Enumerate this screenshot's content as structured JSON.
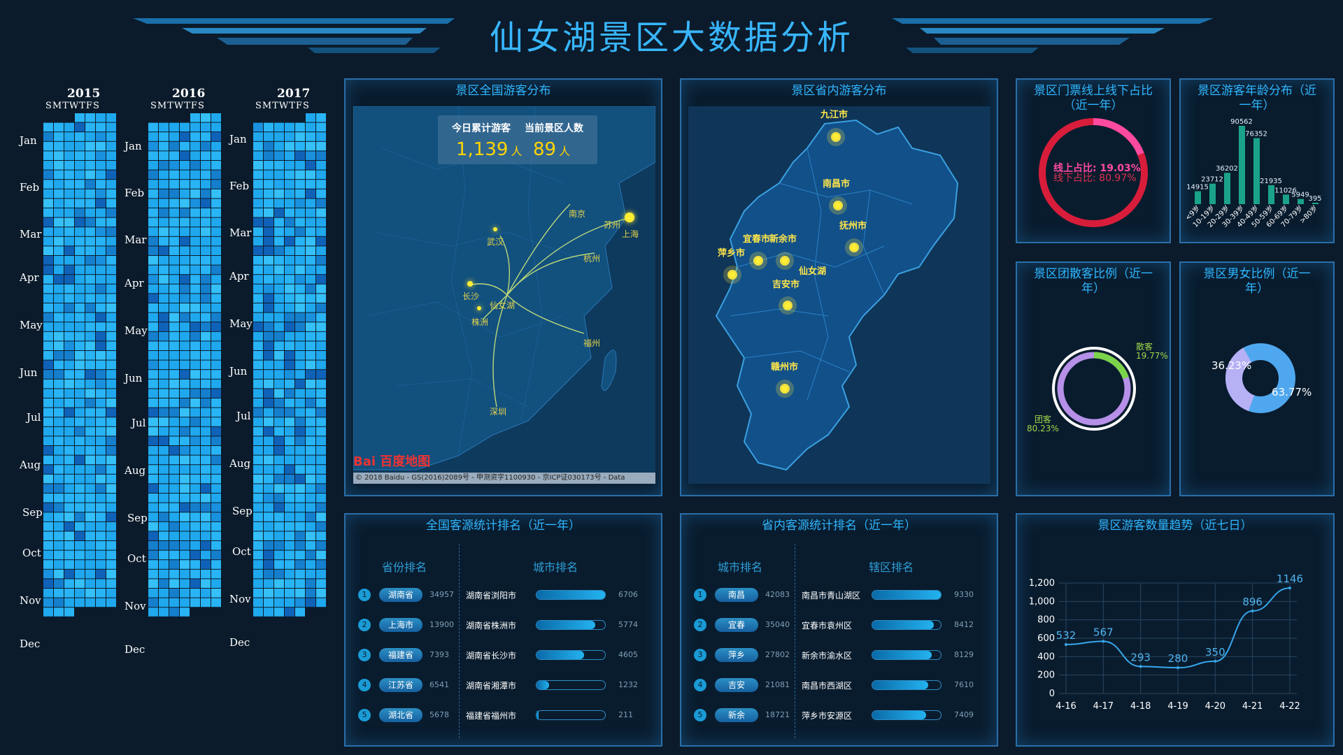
{
  "header": {
    "title": "仙女湖景区大数据分析"
  },
  "calendar": {
    "years": [
      "2015",
      "2016",
      "2017"
    ],
    "weekday_header": "SMTWTFS",
    "months": [
      "Jan",
      "Feb",
      "Mar",
      "Apr",
      "May",
      "Jun",
      "Jul",
      "Aug",
      "Sep",
      "Oct",
      "Nov",
      "Dec"
    ]
  },
  "national_map": {
    "title": "景区全国游客分布",
    "today_label": "今日累计游客",
    "current_label": "当前景区人数",
    "today_value": "1,139",
    "current_value": "89",
    "unit": "人",
    "cities": [
      "南京",
      "苏州",
      "上海",
      "武汉",
      "杭州",
      "长沙",
      "仙女湖",
      "株洲",
      "福州",
      "深圳"
    ],
    "logo_text": "Bai 百度地图",
    "copyright": "© 2018 Baidu - GS(2016)2089号 - 甲测资字1100930 - 京ICP证030173号 - Data"
  },
  "province_map": {
    "title": "景区省内游客分布",
    "cities": [
      "九江市",
      "南昌市",
      "抚州市",
      "宜春市",
      "新余市",
      "萍乡市",
      "仙女湖",
      "吉安市",
      "赣州市"
    ]
  },
  "ticket_ratio": {
    "title": "景区门票线上线下占比（近一年）",
    "online_label": "线上占比: 19.03%",
    "offline_label": "线下占比: 80.97%",
    "online": 19.03,
    "offline": 80.97,
    "colors": {
      "online": "#ff4aa0",
      "offline": "#d81d3a"
    }
  },
  "age_dist": {
    "title": "景区游客年龄分布（近一年）",
    "categories": [
      "<9岁",
      "10-19岁",
      "20-29岁",
      "30-39岁",
      "40-49岁",
      "50-59岁",
      "60-69岁",
      "70-79岁",
      ">80岁"
    ],
    "values": [
      14915,
      23712,
      36202,
      90562,
      76352,
      21935,
      11026,
      5949,
      395
    ],
    "labels": [
      "14915",
      "23712",
      "36202",
      "90562",
      "76352",
      "21935",
      "11026",
      "5949",
      "395"
    ]
  },
  "group_ratio": {
    "title": "景区团散客比例（近一年）",
    "scatter_label": "散客",
    "scatter_value": "19.77%",
    "group_label": "团客",
    "group_value": "80.23%",
    "scatter": 19.77,
    "group": 80.23,
    "colors": {
      "scatter": "#7bd44a",
      "group": "#b690e8"
    }
  },
  "gender_ratio": {
    "title": "景区男女比例（近一年）",
    "a_label": "36.23%",
    "b_label": "63.77%",
    "a": 36.23,
    "b": 63.77,
    "colors": {
      "a": "#b6b0f5",
      "b": "#4fa8ef"
    }
  },
  "national_rank": {
    "title": "全国客源统计排名（近一年）",
    "left_head": "省份排名",
    "right_head": "城市排名",
    "rows": [
      {
        "rank": "1",
        "name": "湖南省",
        "value": "34957",
        "city": "湖南省浏阳市",
        "city_value": "6706",
        "fill": 1.0
      },
      {
        "rank": "2",
        "name": "上海市",
        "value": "13900",
        "city": "湖南省株洲市",
        "city_value": "5774",
        "fill": 0.86
      },
      {
        "rank": "3",
        "name": "福建省",
        "value": "7393",
        "city": "湖南省长沙市",
        "city_value": "4605",
        "fill": 0.69
      },
      {
        "rank": "4",
        "name": "江苏省",
        "value": "6541",
        "city": "湖南省湘潭市",
        "city_value": "1232",
        "fill": 0.18
      },
      {
        "rank": "5",
        "name": "湖北省",
        "value": "5678",
        "city": "福建省福州市",
        "city_value": "211",
        "fill": 0.03
      }
    ]
  },
  "province_rank": {
    "title": "省内客源统计排名（近一年）",
    "left_head": "城市排名",
    "right_head": "辖区排名",
    "rows": [
      {
        "rank": "1",
        "name": "南昌",
        "value": "42083",
        "city": "南昌市青山湖区",
        "city_value": "9330",
        "fill": 1.0
      },
      {
        "rank": "2",
        "name": "宜春",
        "value": "35040",
        "city": "宜春市袁州区",
        "city_value": "8412",
        "fill": 0.9
      },
      {
        "rank": "3",
        "name": "萍乡",
        "value": "27802",
        "city": "新余市渝水区",
        "city_value": "8129",
        "fill": 0.87
      },
      {
        "rank": "4",
        "name": "吉安",
        "value": "21081",
        "city": "南昌市西湖区",
        "city_value": "7610",
        "fill": 0.82
      },
      {
        "rank": "5",
        "name": "新余",
        "value": "18721",
        "city": "萍乡市安源区",
        "city_value": "7409",
        "fill": 0.79
      }
    ]
  },
  "trend": {
    "title": "景区游客数量趋势（近七日）",
    "chart_data": {
      "type": "line",
      "categories": [
        "4-16",
        "4-17",
        "4-18",
        "4-19",
        "4-20",
        "4-21",
        "4-22"
      ],
      "values": [
        532,
        567,
        293,
        280,
        350,
        896,
        1146
      ],
      "ylim": [
        0,
        1200
      ],
      "yticks": [
        "0",
        "200",
        "400",
        "600",
        "800",
        "1,000",
        "1,200"
      ],
      "grid": true,
      "color": "#37a7ea"
    }
  }
}
